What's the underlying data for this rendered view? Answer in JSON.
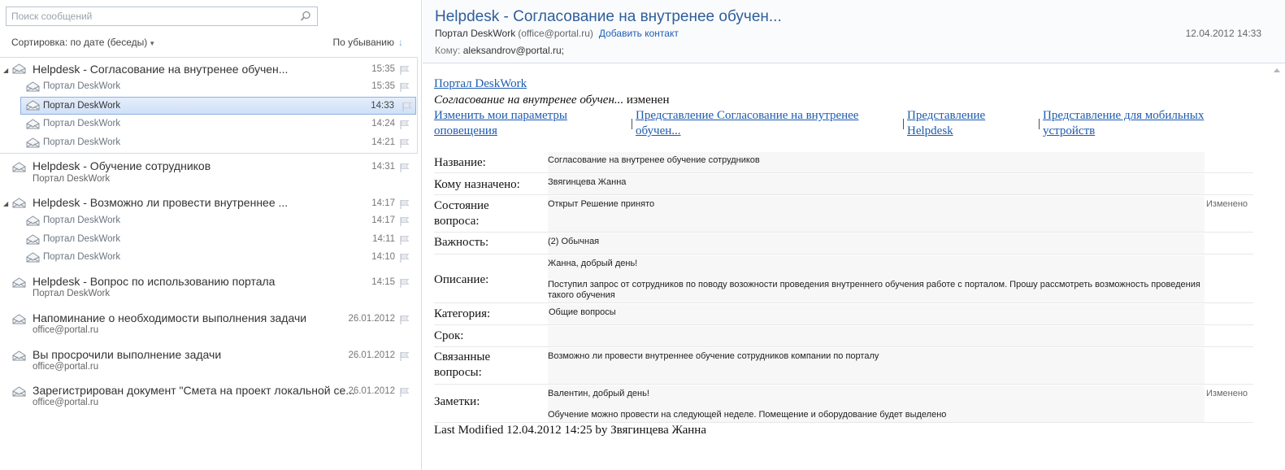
{
  "search": {
    "placeholder": "Поиск сообщений"
  },
  "sort": {
    "by_label": "Сортировка: по дате (беседы)",
    "order_label": "По убыванию"
  },
  "list": {
    "conv1": {
      "subject": "Helpdesk - Согласование на внутренее обучен...",
      "time": "15:35",
      "children": [
        {
          "sender": "Портал DeskWork",
          "time": "15:35"
        },
        {
          "sender": "Портал DeskWork",
          "time": "14:33"
        },
        {
          "sender": "Портал DeskWork",
          "time": "14:24"
        },
        {
          "sender": "Портал DeskWork",
          "time": "14:21"
        }
      ]
    },
    "conv2": {
      "subject": "Helpdesk - Обучение сотрудников",
      "sender": "Портал DeskWork",
      "time": "14:31"
    },
    "conv3": {
      "subject": "Helpdesk - Возможно ли провести внутреннее ...",
      "time": "14:17",
      "children": [
        {
          "sender": "Портал DeskWork",
          "time": "14:17"
        },
        {
          "sender": "Портал DeskWork",
          "time": "14:11"
        },
        {
          "sender": "Портал DeskWork",
          "time": "14:10"
        }
      ]
    },
    "conv4": {
      "subject": "Helpdesk - Вопрос по использованию портала",
      "sender": "Портал DeskWork",
      "time": "14:15"
    },
    "conv5": {
      "subject": "Напоминание о необходимости выполнения задачи",
      "sender": "office@portal.ru",
      "time": "26.01.2012"
    },
    "conv6": {
      "subject": "Вы просрочили выполнение задачи",
      "sender": "office@portal.ru",
      "time": "26.01.2012"
    },
    "conv7": {
      "subject": "Зарегистрирован документ \"Смета на проект локальной се...",
      "sender": "office@portal.ru",
      "time": "26.01.2012"
    }
  },
  "message": {
    "title": "Helpdesk - Согласование на внутренее обучен...",
    "from_name": "Портал DeskWork",
    "from_addr": "(office@portal.ru)",
    "add_contact": "Добавить контакт",
    "date": "12.04.2012 14:33",
    "to_label": "Кому:",
    "to_value": "aleksandrov@portal.ru;",
    "body": {
      "portal_link": "Портал DeskWork",
      "change_item": "Согласование на внутренее обучен...",
      "change_suffix": " изменен",
      "links": [
        "Изменить мои параметры оповещения",
        "Представление Согласование на внутренее обучен...",
        "Представление Helpdesk",
        "Представление для мобильных устройств"
      ],
      "sep": "|",
      "fields": {
        "name": {
          "label": "Название:",
          "value": "Согласование на внутренее обучение сотрудников"
        },
        "assigned": {
          "label": "Кому назначено:",
          "value": "Звягинцева Жанна"
        },
        "status": {
          "label": "Состояние вопроса:",
          "value": "Открыт Решение принято",
          "changed": "Изменено"
        },
        "priority": {
          "label": "Важность:",
          "value": "(2) Обычная"
        },
        "description": {
          "label": "Описание:",
          "p1": "Жанна, добрый день!",
          "p2": "Поступил запрос от сотрудников по поводу возожности проведения внутреннего обучения работе с порталом. Прошу рассмотреть возможность проведения такого обучения"
        },
        "category": {
          "label": "Категория:",
          "value": "Общие вопросы"
        },
        "due": {
          "label": "Срок:",
          "value": ""
        },
        "related": {
          "label": "Связанные вопросы:",
          "value": "Возможно ли провести внутреннее обучение сотрудников компании по порталу"
        },
        "notes": {
          "label": "Заметки:",
          "p1": "Валентин, добрый день!",
          "p2": "Обучение можно провести на следующей неделе. Помещение и оборудование будет выделено",
          "changed": "Изменено"
        }
      },
      "last_modified": "Last Modified 12.04.2012 14:25 by Звягинцева Жанна"
    }
  },
  "colors": {
    "title_blue": "#2e5f9a",
    "link_blue": "#1c5bb0",
    "selection": "#cfe0f7"
  },
  "icons": [
    "search-icon",
    "envelope-icon",
    "envelope-open-icon",
    "flag-icon",
    "expand-arrow-icon",
    "sort-down-arrow-icon"
  ]
}
